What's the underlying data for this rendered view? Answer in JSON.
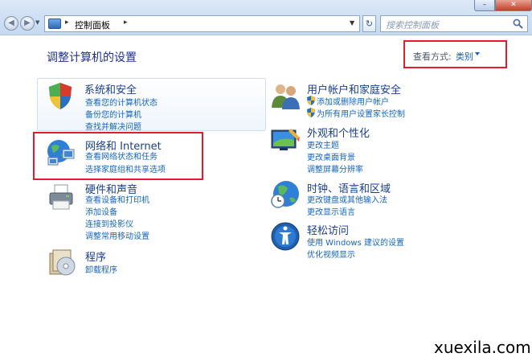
{
  "address": {
    "path": "控制面板",
    "separator": "▸"
  },
  "search": {
    "placeholder": "搜索控制面板"
  },
  "page_title": "调整计算机的设置",
  "view": {
    "label": "查看方式:",
    "value": "类别"
  },
  "categories": {
    "system": {
      "title": "系统和安全",
      "links": [
        "查看您的计算机状态",
        "备份您的计算机",
        "查找并解决问题"
      ]
    },
    "network": {
      "title": "网络和 Internet",
      "links": [
        "查看网络状态和任务",
        "选择家庭组和共享选项"
      ]
    },
    "hardware": {
      "title": "硬件和声音",
      "links": [
        "查看设备和打印机",
        "添加设备",
        "连接到投影仪",
        "调整常用移动设置"
      ]
    },
    "programs": {
      "title": "程序",
      "links": [
        "卸载程序"
      ]
    },
    "users": {
      "title": "用户帐户和家庭安全",
      "links": [
        "添加或删除用户帐户",
        "为所有用户设置家长控制"
      ]
    },
    "appearance": {
      "title": "外观和个性化",
      "links": [
        "更改主题",
        "更改桌面背景",
        "调整屏幕分辨率"
      ]
    },
    "clock": {
      "title": "时钟、语言和区域",
      "links": [
        "更改键盘或其他输入法",
        "更改显示语言"
      ]
    },
    "ease": {
      "title": "轻松访问",
      "links": [
        "使用 Windows 建议的设置",
        "优化视频显示"
      ]
    }
  },
  "watermark": "xuexila.com",
  "colors": {
    "highlight_box": "#e21c2b",
    "link": "#1565c0",
    "title": "#1e3287"
  }
}
